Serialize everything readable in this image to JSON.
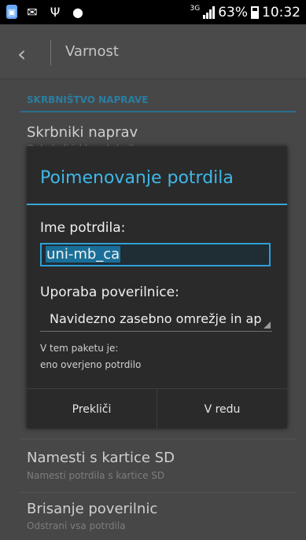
{
  "status_bar": {
    "network": "3G",
    "battery": "63%",
    "time": "10:32",
    "icons": [
      "app-icon",
      "mail-icon",
      "usb-icon",
      "game-icon"
    ]
  },
  "app_bar": {
    "title": "Varnost",
    "back_glyph": "‹"
  },
  "settings": {
    "section_header": "SKRBNIŠTVO NAPRAVE",
    "items": [
      {
        "title": "Skrbniki naprav",
        "subtitle": "Ogled ali izklop skrbnikov"
      },
      {
        "title": "Namesti s kartice SD",
        "subtitle": "Namesti potrdila s kartice SD"
      },
      {
        "title": "Brisanje poverilnic",
        "subtitle": "Odstrani vsa potrdila"
      }
    ]
  },
  "dialog": {
    "title": "Poimenovanje potrdila",
    "name_label": "Ime potrdila:",
    "name_value": "uni-mb_ca",
    "usage_label": "Uporaba poverilnice:",
    "usage_value": "Navidezno zasebno omrežje in ap",
    "info_line1": "V tem paketu je:",
    "info_line2": "eno overjeno potrdilo",
    "cancel_label": "Prekliči",
    "ok_label": "V redu"
  },
  "colors": {
    "accent": "#3eb8e8",
    "dialog_bg": "#2a2a2a",
    "dim_bg": "#474747"
  }
}
